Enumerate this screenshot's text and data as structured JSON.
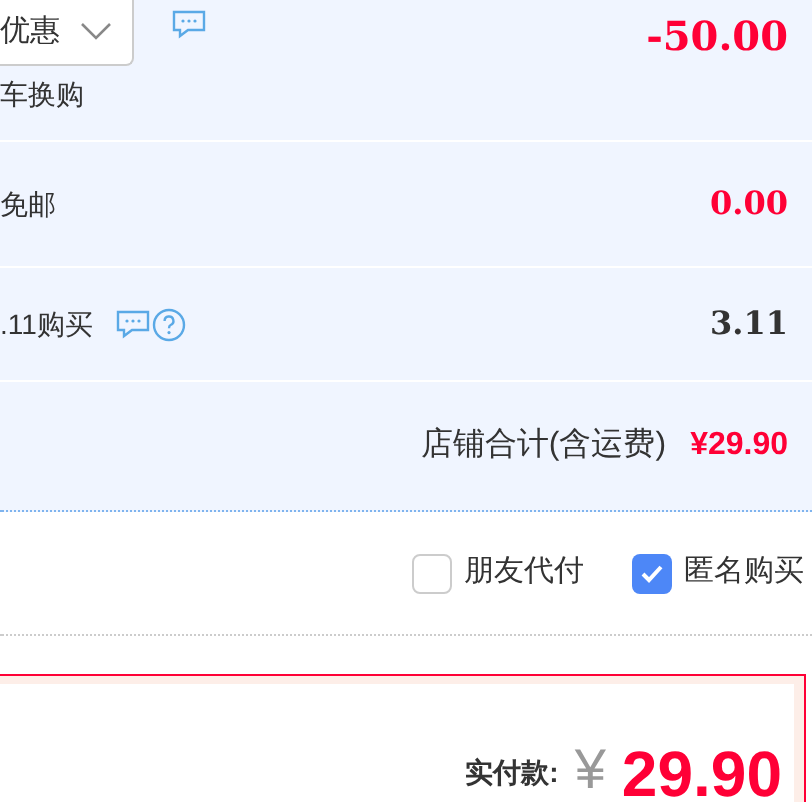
{
  "promotions": [
    {
      "kind": "select",
      "label": "优惠",
      "note": "车换购",
      "amount": "-50.00",
      "highlight": true,
      "chat": true,
      "help": false
    },
    {
      "kind": "text",
      "label": "免邮",
      "amount": "0.00",
      "highlight": true,
      "chat": false,
      "help": false
    },
    {
      "kind": "text",
      "label": ".11购买",
      "amount": "3.11",
      "highlight": false,
      "chat": true,
      "help": true
    }
  ],
  "store_total": {
    "label": "店铺合计(含运费)",
    "amount": "¥29.90"
  },
  "options": [
    {
      "label": "朋友代付",
      "checked": false
    },
    {
      "label": "匿名购买",
      "checked": true
    }
  ],
  "payment": {
    "label": "实付款:",
    "currency": "¥",
    "amount": "29.90"
  }
}
